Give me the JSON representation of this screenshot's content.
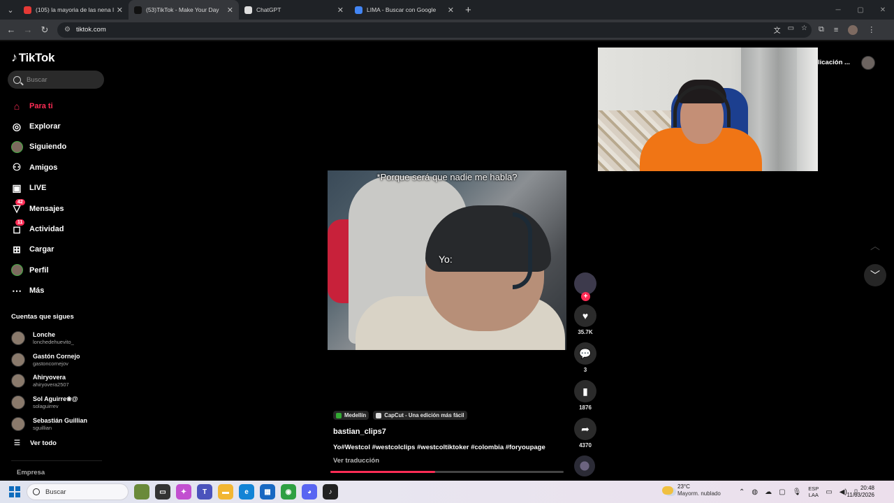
{
  "browser": {
    "tabs": [
      {
        "title": "(105) la mayoria de las nena lin",
        "active": false,
        "favicon_color": "#e53935"
      },
      {
        "title": "(53)TikTok - Make Your Day",
        "active": true,
        "favicon_color": "#111111"
      },
      {
        "title": "ChatGPT",
        "active": false,
        "favicon_color": "#dddddd"
      },
      {
        "title": "LIMA - Buscar con Google",
        "active": false,
        "favicon_color": "#4285f4"
      }
    ],
    "url": "tiktok.com"
  },
  "tiktok": {
    "logo": "TikTok",
    "search_placeholder": "Buscar",
    "nav": [
      {
        "label": "Para ti",
        "icon": "home-icon",
        "glyph": "⌂",
        "active": true
      },
      {
        "label": "Explorar",
        "icon": "compass-icon",
        "glyph": "◎"
      },
      {
        "label": "Siguiendo",
        "icon": "following-avatar-icon",
        "glyph": "●"
      },
      {
        "label": "Amigos",
        "icon": "friends-icon",
        "glyph": "⚇"
      },
      {
        "label": "LIVE",
        "icon": "live-icon",
        "glyph": "▣"
      },
      {
        "label": "Mensajes",
        "icon": "messages-icon",
        "glyph": "▽",
        "badge": "42"
      },
      {
        "label": "Actividad",
        "icon": "activity-icon",
        "glyph": "◻",
        "badge": "11"
      },
      {
        "label": "Cargar",
        "icon": "upload-icon",
        "glyph": "⊞"
      },
      {
        "label": "Perfil",
        "icon": "profile-avatar-icon",
        "glyph": "●"
      },
      {
        "label": "Más",
        "icon": "more-icon",
        "glyph": "⋯"
      }
    ],
    "following_heading": "Cuentas que sigues",
    "following": [
      {
        "name": "Lonche",
        "username": "lonchedehuevito_"
      },
      {
        "name": "Gastón Cornejo",
        "username": "gastoncornejov"
      },
      {
        "name": "Ahiryovera",
        "username": "ahiryovera2507"
      },
      {
        "name": "Sol Aguirre❀@",
        "username": "solaguirrev"
      },
      {
        "name": "Sebastián Guillian",
        "username": "sguillian"
      }
    ],
    "see_all": "Ver todo",
    "footer_link": "Empresa",
    "top_right_text": "licación ...",
    "video": {
      "caption": "*Porque será que nadie me habla?",
      "overlay_text": "Yo:",
      "chips": [
        "Medellín",
        "CapCut - Una edición más fácil"
      ],
      "author": "bastian_clips7",
      "description": "Yo#Westcol #westcolclips #westcoltiktoker #colombia #foryoupage",
      "translate": "Ver traducción",
      "progress": 0.45
    },
    "actions": {
      "likes": "35.7K",
      "comments": "3",
      "saves": "1876",
      "shares": "4370"
    }
  },
  "taskbar": {
    "search_placeholder": "Buscar",
    "weather_temp": "23°C",
    "weather_desc": "Mayorm. nublado",
    "lang_top": "ESP",
    "lang_bottom": "LAA",
    "time": "20:48",
    "date": "11/03/2026"
  }
}
